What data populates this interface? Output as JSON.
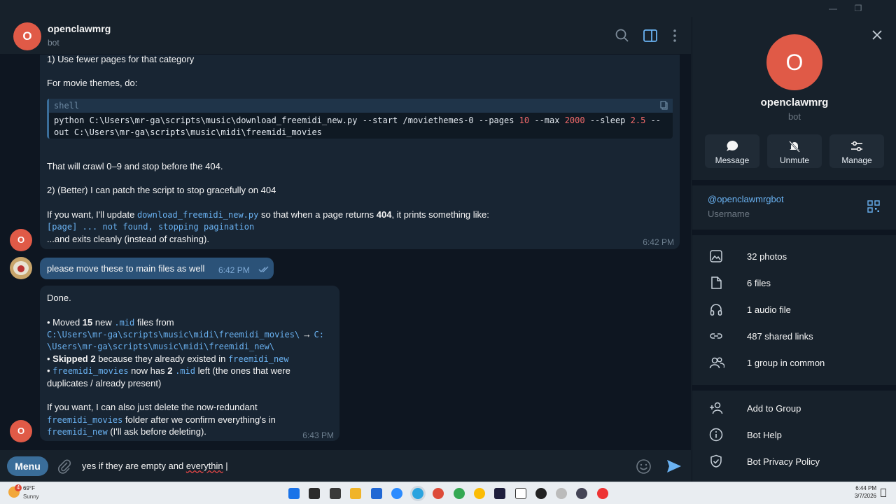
{
  "colors": {
    "accent": "#6ab2f2",
    "avatar": "#e05a47",
    "bubble_in": "#182533",
    "bubble_out": "#2b5278",
    "menu": "#3a6d99"
  },
  "window": {
    "minimize_icon": "minimize-icon",
    "restore_icon": "restore-icon"
  },
  "chat": {
    "name": "openclawmrg",
    "status": "bot",
    "avatar_letter": "O"
  },
  "messages": {
    "m1": {
      "line1": "1) Use fewer pages for that category",
      "line2": "For movie themes, do:",
      "code_lang": "shell",
      "code_line1_a": "python C:\\Users\\mr-ga\\scripts\\music\\download_freemidi_new.py --start /moviethemes-0 --pages ",
      "code_num1": "10",
      "code_line1_b": " --max ",
      "code_num2": "2000",
      "code_line1_c": " --sleep ",
      "code_num3": "2.5",
      "code_line1_d": " --",
      "code_line2": "out C:\\Users\\mr-ga\\scripts\\music\\midi\\freemidi_movies",
      "line3": "That will crawl 0–9 and stop before the 404.",
      "line4": "2) (Better) I can patch the script to stop gracefully on 404",
      "line5_a": "If you want, I'll update ",
      "line5_code": "download_freemidi_new.py",
      "line5_b": " so that when a page returns ",
      "line5_bold": "404",
      "line5_c": ", it prints something like:",
      "line6_code": "[page] ... not found, stopping pagination",
      "line7": "...and exits cleanly (instead of crashing).",
      "time": "6:42 PM"
    },
    "m2": {
      "text": "please move these to main files as well",
      "time": "6:42 PM"
    },
    "m3": {
      "line1": "Done.",
      "b1_a": "• Moved ",
      "b1_bold": "15",
      "b1_b": " new ",
      "b1_code": ".mid",
      "b1_c": " files from",
      "b1_path1": "C:\\Users\\mr-ga\\scripts\\music\\midi\\freemidi_movies\\",
      "b1_arrow": " → ",
      "b1_path2a": "C:",
      "b1_path2b": "\\Users\\mr-ga\\scripts\\music\\midi\\freemidi_new\\",
      "b2_a": "• ",
      "b2_bold": "Skipped 2",
      "b2_b": " because they already existed in ",
      "b2_code": "freemidi_new",
      "b3_a": "• ",
      "b3_code": "freemidi_movies",
      "b3_b": " now has ",
      "b3_bold": "2",
      "b3_code2": ".mid",
      "b3_c": " left (the ones that were",
      "b3_line2": "duplicates / already present)",
      "p_line1": "If you want, I can also just delete the now-redundant",
      "p_code1": "freemidi_movies",
      "p_line2": " folder after we confirm everything's in",
      "p_code2": "freemidi_new",
      "p_line3": " (I'll ask before deleting).",
      "time": "6:43 PM"
    }
  },
  "input": {
    "menu_label": "Menu",
    "text_a": "yes if they are empty and ",
    "text_typo": "everythin",
    "text_cursor": " |"
  },
  "profile": {
    "name": "openclawmrg",
    "status": "bot",
    "avatar_letter": "O",
    "actions": [
      "Message",
      "Unmute",
      "Manage"
    ],
    "username": "@openclawmrgbot",
    "username_label": "Username",
    "media": [
      "32 photos",
      "6 files",
      "1 audio file",
      "487 shared links",
      "1 group in common"
    ],
    "links": [
      "Add to Group",
      "Bot Help",
      "Bot Privacy Policy"
    ]
  },
  "taskbar": {
    "weather_temp": "69°F",
    "weather_desc": "Sunny",
    "weather_badge": "4",
    "time": "6:44 PM",
    "date": "3/7/2026"
  }
}
